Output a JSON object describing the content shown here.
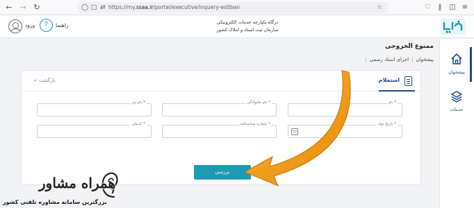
{
  "browser": {
    "url_prefix": "https://my.",
    "url_host": "ssaa.ir",
    "url_path": "/portal/executive/inquery-estlban"
  },
  "header": {
    "login_label": "ورود",
    "help_label": "راهنما",
    "org_line1": "درگاه یکپارچه خدمات الکترونیکی",
    "org_line2": "سازمان ثبت اسناد و املاک کشور",
    "logo_text": "ثبت من"
  },
  "sidebar": {
    "items": [
      {
        "label": "پیشخوان",
        "icon": "home-icon"
      },
      {
        "label": "خدمات",
        "icon": "layers-icon"
      }
    ]
  },
  "page": {
    "title": "ممنوع الخروجی",
    "breadcrumb": [
      "پیشخوان",
      "اجرای اسناد رسمی"
    ]
  },
  "card": {
    "title": "استعلام",
    "back_label": "بازگشت",
    "fields": {
      "name": {
        "label": "نام",
        "value": ""
      },
      "family": {
        "label": "نام خانوادگی",
        "value": ""
      },
      "father": {
        "label": "نام پدر",
        "value": ""
      },
      "birth_date": {
        "label": "تاریخ تولد",
        "value": ""
      },
      "id_number": {
        "label": "شماره شناسنامه",
        "value": ""
      },
      "national_code": {
        "label": "کدملی",
        "value": ""
      }
    },
    "submit_label": "بررسی"
  },
  "watermark": {
    "title": "همراه مشاور",
    "subtitle": "بزرگترین سامانه مشاوره تلفنی کشور"
  },
  "colors": {
    "primary": "#1e4a8c",
    "accent": "#1e9bb4",
    "required": "#d32f2f",
    "arrow": "#f0940f"
  }
}
